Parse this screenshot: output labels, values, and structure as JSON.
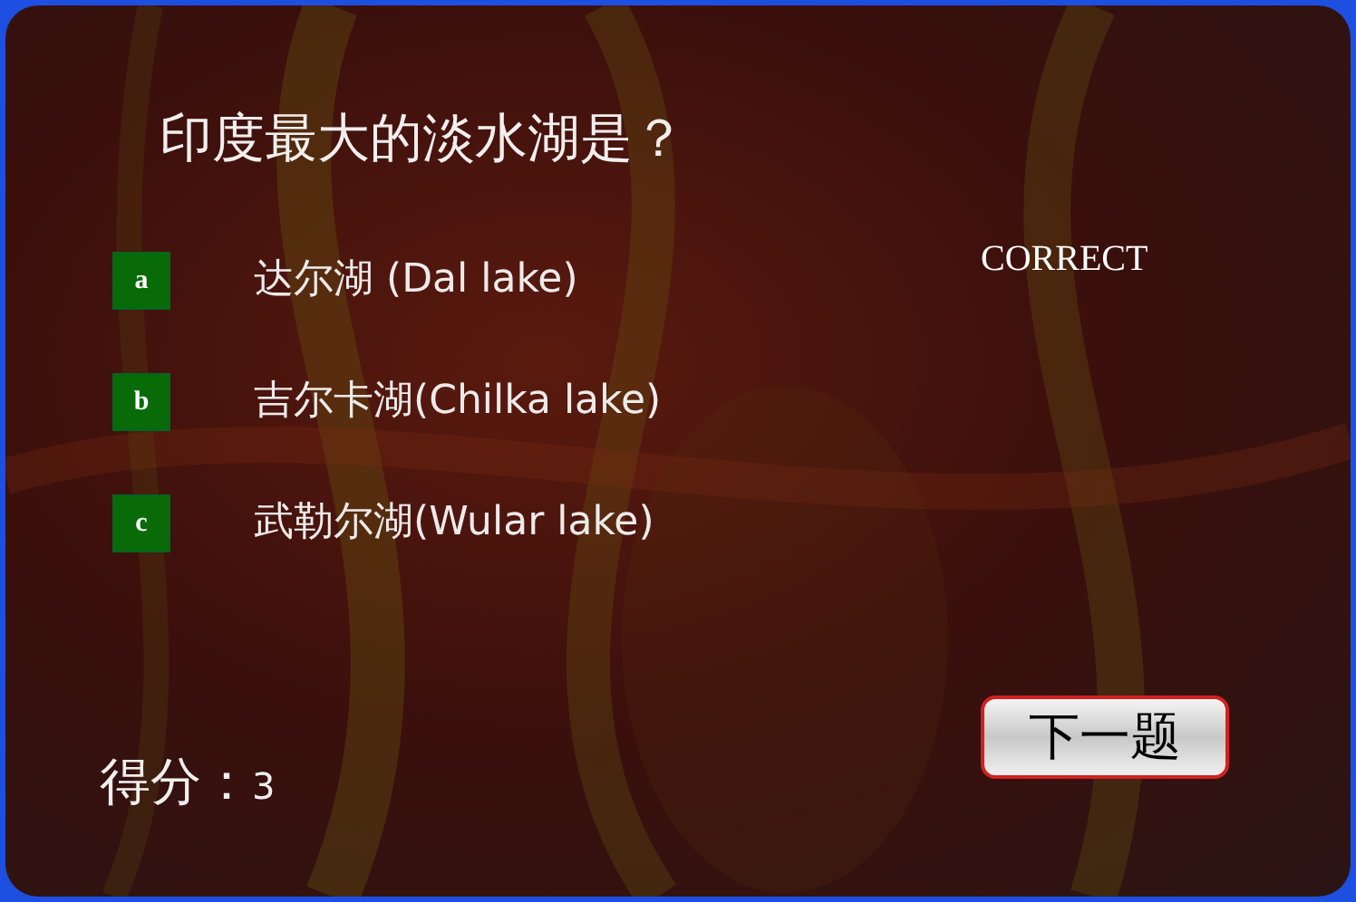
{
  "question": "印度最大的淡水湖是？",
  "options": [
    {
      "letter": "a",
      "text": "达尔湖 (Dal lake)"
    },
    {
      "letter": "b",
      "text": "吉尔卡湖(Chilka lake)"
    },
    {
      "letter": "c",
      "text": "武勒尔湖(Wular lake)"
    }
  ],
  "feedback": "CORRECT",
  "next_button": "下一题",
  "score": {
    "label": "得分：",
    "value": "3"
  }
}
